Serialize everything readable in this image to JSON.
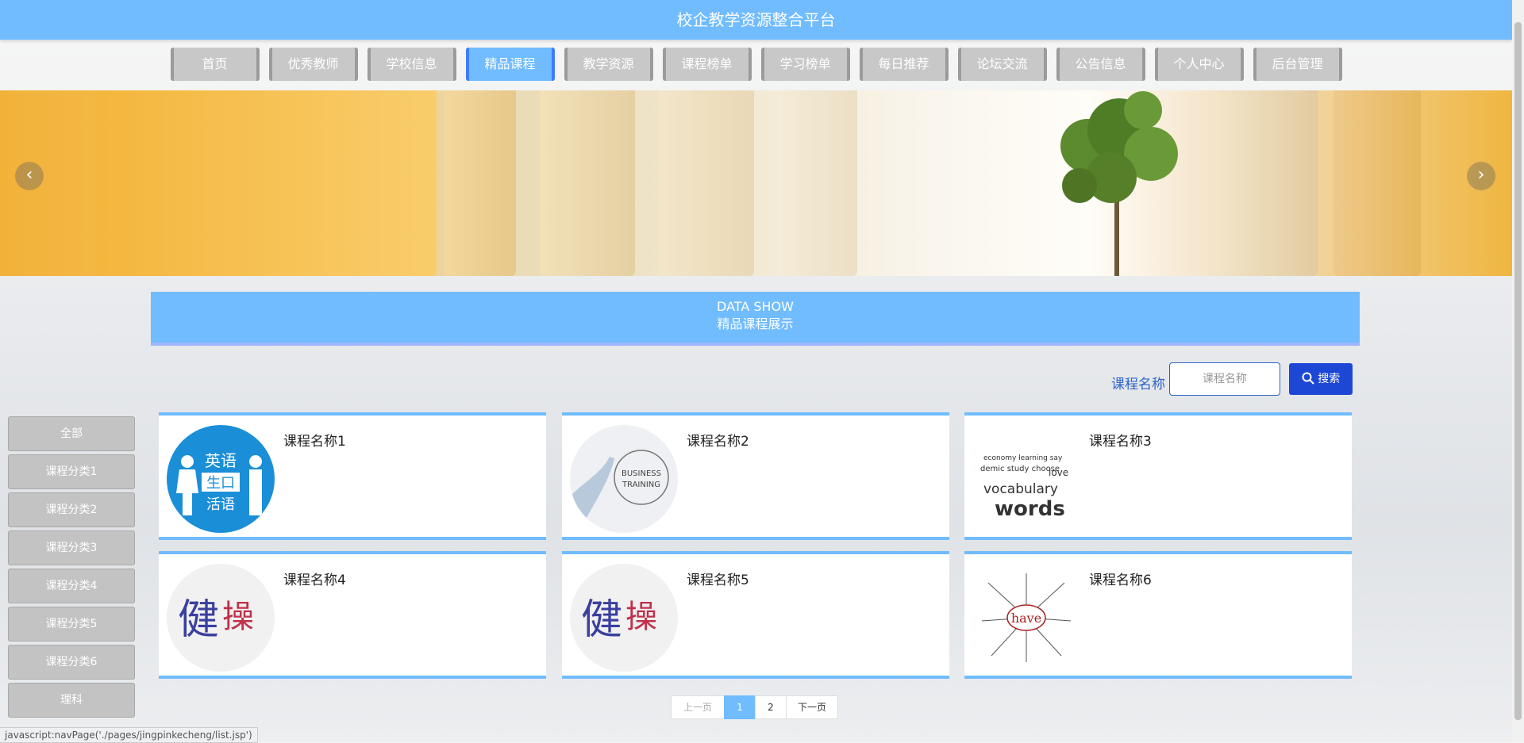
{
  "header": {
    "title": "校企教学资源整合平台"
  },
  "nav": [
    {
      "label": "首页"
    },
    {
      "label": "优秀教师"
    },
    {
      "label": "学校信息"
    },
    {
      "label": "精品课程",
      "active": true
    },
    {
      "label": "教学资源"
    },
    {
      "label": "课程榜单"
    },
    {
      "label": "学习榜单"
    },
    {
      "label": "每日推荐"
    },
    {
      "label": "论坛交流"
    },
    {
      "label": "公告信息"
    },
    {
      "label": "个人中心"
    },
    {
      "label": "后台管理"
    }
  ],
  "banner": {
    "prev_icon": "chevron-left-icon",
    "next_icon": "chevron-right-icon",
    "prev_glyph": "‹",
    "next_glyph": "›"
  },
  "section": {
    "title_en": "DATA SHOW",
    "title_cn": "精品课程展示"
  },
  "search": {
    "label": "课程名称",
    "placeholder": "课程名称",
    "button": "搜索"
  },
  "categories": [
    "全部",
    "课程分类1",
    "课程分类2",
    "课程分类3",
    "课程分类4",
    "课程分类5",
    "课程分类6",
    "理科"
  ],
  "courses": [
    {
      "title": "课程名称1",
      "image": "english-oral-icon",
      "image_text": [
        "英语",
        "生口",
        "活语"
      ]
    },
    {
      "title": "课程名称2",
      "image": "business-training-icon",
      "image_text": [
        "BUSINESS",
        "TRAINING"
      ]
    },
    {
      "title": "课程名称3",
      "image": "vocabulary-word-cloud-icon",
      "image_text": [
        "vocabulary",
        "words"
      ]
    },
    {
      "title": "课程名称4",
      "image": "fitness-calligraphy-icon",
      "image_text": [
        "健",
        "操"
      ]
    },
    {
      "title": "课程名称5",
      "image": "fitness-calligraphy-icon",
      "image_text": [
        "健",
        "操"
      ]
    },
    {
      "title": "课程名称6",
      "image": "have-mindmap-icon",
      "image_text": [
        "have"
      ]
    }
  ],
  "pagination": {
    "prev": "上一页",
    "pages": [
      "1",
      "2"
    ],
    "current": "1",
    "next": "下一页"
  },
  "statusbar": {
    "text": "javascript:navPage('./pages/jingpinkecheng/list.jsp')"
  },
  "colors": {
    "primary": "#70bcff",
    "accent": "#1d48d6",
    "nav_inactive": "#c8c8c8",
    "category": "#c3c3c3"
  }
}
